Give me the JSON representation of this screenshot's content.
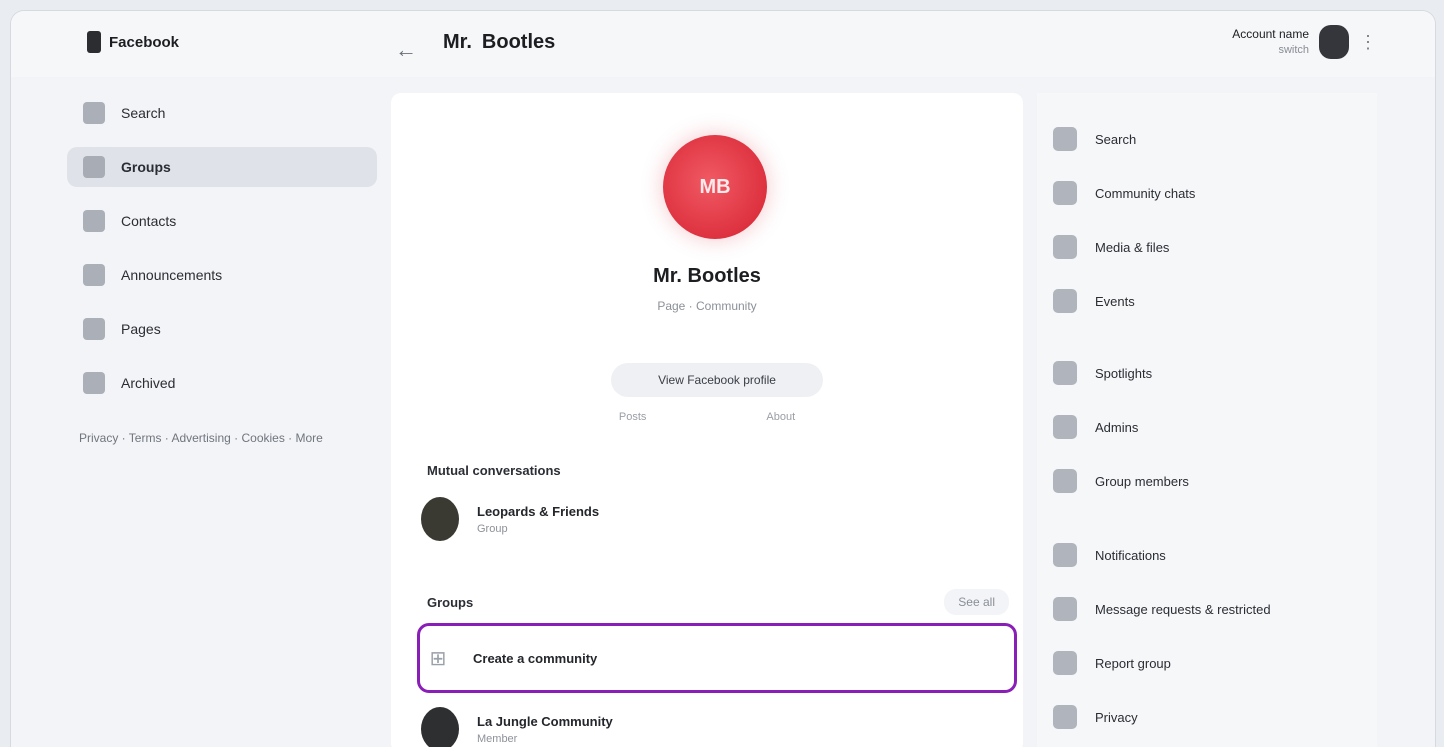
{
  "app": {
    "brand": "Facebook"
  },
  "header": {
    "back_icon": "arrow-left-icon",
    "title_short": "Mr.",
    "title_name": "Bootles",
    "account_name": "Account name",
    "account_sub": "switch",
    "more_icon": "more-icon"
  },
  "sidebar": {
    "items": [
      {
        "label": "Search",
        "icon": "search-icon"
      },
      {
        "label": "Groups",
        "icon": "groups-icon"
      },
      {
        "label": "Contacts",
        "icon": "contacts-icon"
      },
      {
        "label": "Announcements",
        "icon": "announcements-icon"
      },
      {
        "label": "Pages",
        "icon": "pages-icon"
      },
      {
        "label": "Archived",
        "icon": "archive-icon"
      }
    ],
    "footer": "Privacy · Terms · Advertising · Cookies · More"
  },
  "profile": {
    "avatar_initials": "MB",
    "name": "Mr. Bootles",
    "subtitle": "Page · Community",
    "action_button": "View Facebook profile",
    "tabs": [
      "Posts",
      "About"
    ]
  },
  "mutual": {
    "title": "Mutual conversations",
    "item": {
      "title": "Leopards & Friends",
      "sub": "Group"
    }
  },
  "groups": {
    "title": "Groups",
    "see_all": "See all",
    "rows": [
      {
        "title": "Create a community",
        "sub": "",
        "icon": "add-group-icon"
      },
      {
        "title": "La Jungle Community",
        "sub": "Member",
        "icon": ""
      }
    ]
  },
  "rightpanel": {
    "items": [
      {
        "label": "Search",
        "icon": "search-icon"
      },
      {
        "label": "Community chats",
        "icon": "chat-icon"
      },
      {
        "label": "Media & files",
        "icon": "media-icon"
      },
      {
        "label": "Events",
        "icon": "calendar-icon"
      },
      {
        "label": "Spotlights",
        "icon": "spotlight-icon"
      },
      {
        "label": "Admins",
        "icon": "admin-icon"
      },
      {
        "label": "Group members",
        "icon": "members-icon"
      },
      {
        "label": "Notifications",
        "icon": "bell-icon"
      },
      {
        "label": "Message requests & restricted",
        "icon": "inbox-icon"
      },
      {
        "label": "Report group",
        "icon": "flag-icon"
      },
      {
        "label": "Privacy",
        "icon": "lock-icon"
      }
    ]
  },
  "colors": {
    "accent": "#8a1fb8",
    "avatar": "#d6202f"
  }
}
